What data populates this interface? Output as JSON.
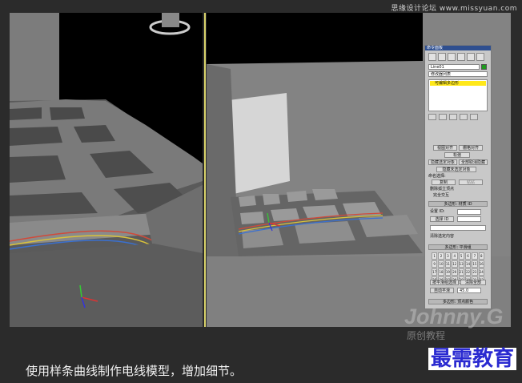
{
  "header": {
    "watermark": "思缘设计论坛 www.missyuan.com"
  },
  "viewports": {
    "left": {
      "name": "perspective-viewport-left"
    },
    "right": {
      "name": "perspective-viewport-right"
    }
  },
  "panel": {
    "title": "命令面板",
    "object_name": "Line01",
    "modifier_list": "修改器列表",
    "modifier_item": "可编辑多边形",
    "buttons": {
      "view_align": "视图对齐",
      "grid_align": "栅格对齐",
      "relax": "松弛",
      "hide_selected": "隐藏选定对象",
      "unhide_all": "全部取消隐藏",
      "hide_unselected": "隐藏未选定对象",
      "named_selection": "命名选择:",
      "copy": "复制",
      "paste": "粘贴",
      "delete_isolated": "删除孤立顶点",
      "full_interactivity": "完全交互",
      "smooth_group_rollout": "多边形: 材质 ID",
      "set_id": "设置 ID:",
      "select_id": "选择 ID",
      "clear_selection": "清除选定内容",
      "smooth_rollout": "多边形: 平滑组",
      "select_by_smooth": "按平滑组选择",
      "clear_all": "清除全部",
      "auto_smooth": "自动平滑",
      "auto_smooth_value": "45.0",
      "vertex_color_rollout": "多边形: 顶点颜色"
    },
    "smooth_groups": [
      "1",
      "2",
      "3",
      "4",
      "5",
      "6",
      "7",
      "8",
      "9",
      "10",
      "11",
      "12",
      "13",
      "14",
      "15",
      "16",
      "17",
      "18",
      "19",
      "20",
      "21",
      "22",
      "23",
      "24",
      "25",
      "26",
      "27",
      "28",
      "29",
      "30",
      "31",
      "32"
    ]
  },
  "watermark": {
    "main": "Johnny.G",
    "sub": "原创教程"
  },
  "caption": "使用样条曲线制作电线模型，增加细节。",
  "brand": "最需教育"
}
